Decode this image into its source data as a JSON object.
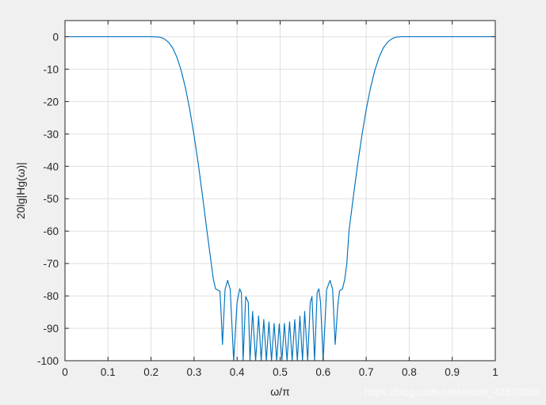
{
  "chart_data": {
    "type": "line",
    "title": "",
    "xlabel": "ω/π",
    "ylabel": "20lg|Hg(ω)|",
    "xlim": [
      0,
      1
    ],
    "ylim": [
      -100,
      5
    ],
    "x_ticks": [
      0,
      0.1,
      0.2,
      0.3,
      0.4,
      0.5,
      0.6,
      0.7,
      0.8,
      0.9,
      1
    ],
    "x_tick_labels": [
      "0",
      "0.1",
      "0.2",
      "0.3",
      "0.4",
      "0.5",
      "0.6",
      "0.7",
      "0.8",
      "0.9",
      "1"
    ],
    "y_ticks": [
      0,
      -10,
      -20,
      -30,
      -40,
      -50,
      -60,
      -70,
      -80,
      -90,
      -100
    ],
    "y_tick_labels": [
      "0",
      "-10",
      "-20",
      "-30",
      "-40",
      "-50",
      "-60",
      "-70",
      "-80",
      "-90",
      "-100"
    ],
    "grid": true,
    "colors": {
      "figure_bg": "#f0f0f0",
      "axes_bg": "#ffffff",
      "axis_color": "#262626",
      "grid_color": "#dfdfdf",
      "line_color": "#0072bd"
    },
    "series": [
      {
        "name": "",
        "x": [
          0,
          0.05,
          0.1,
          0.15,
          0.2,
          0.22,
          0.23,
          0.24,
          0.25,
          0.26,
          0.27,
          0.28,
          0.29,
          0.3,
          0.31,
          0.32,
          0.33,
          0.34,
          0.345,
          0.35,
          0.355,
          0.36,
          0.362,
          0.366,
          0.372,
          0.378,
          0.384,
          0.392,
          0.4,
          0.406,
          0.41,
          0.414,
          0.42,
          0.426,
          0.43,
          0.436,
          0.443,
          0.45,
          0.456,
          0.462,
          0.468,
          0.474,
          0.48,
          0.486,
          0.492,
          0.498,
          0.504,
          0.51,
          0.516,
          0.522,
          0.528,
          0.534,
          0.54,
          0.546,
          0.552,
          0.557,
          0.564,
          0.57,
          0.574,
          0.58,
          0.586,
          0.59,
          0.594,
          0.6,
          0.608,
          0.616,
          0.622,
          0.628,
          0.634,
          0.638,
          0.64,
          0.645,
          0.65,
          0.655,
          0.66,
          0.67,
          0.68,
          0.69,
          0.7,
          0.71,
          0.72,
          0.73,
          0.74,
          0.75,
          0.76,
          0.77,
          0.78,
          0.8,
          0.85,
          0.9,
          0.95,
          1
        ],
        "y": [
          0,
          0,
          0,
          0,
          0,
          -0.1,
          -0.6,
          -1.6,
          -3.4,
          -6.3,
          -10.4,
          -15.8,
          -22.5,
          -30.5,
          -39.5,
          -49.5,
          -60,
          -70,
          -75,
          -77.8,
          -78.2,
          -78.5,
          -83,
          -95,
          -78,
          -75.2,
          -78,
          -100,
          -82,
          -77.8,
          -79,
          -100,
          -80.2,
          -82,
          -100,
          -84.8,
          -100,
          -86.2,
          -100,
          -87.3,
          -100,
          -88,
          -100,
          -88.5,
          -100,
          -88.6,
          -100,
          -88.5,
          -100,
          -88,
          -100,
          -87.3,
          -100,
          -86.2,
          -100,
          -84.8,
          -100,
          -82,
          -80.2,
          -100,
          -79,
          -77.8,
          -82,
          -100,
          -78,
          -75.2,
          -78,
          -95,
          -83,
          -78.5,
          -78.2,
          -77.8,
          -75,
          -70,
          -60,
          -49.5,
          -39.5,
          -30.5,
          -22.5,
          -15.8,
          -10.4,
          -6.3,
          -3.4,
          -1.6,
          -0.6,
          -0.1,
          0,
          0,
          0,
          0,
          0,
          0
        ]
      }
    ]
  },
  "overlay": {
    "watermark": "https://blog.csdn.net/weixin_42870380"
  }
}
